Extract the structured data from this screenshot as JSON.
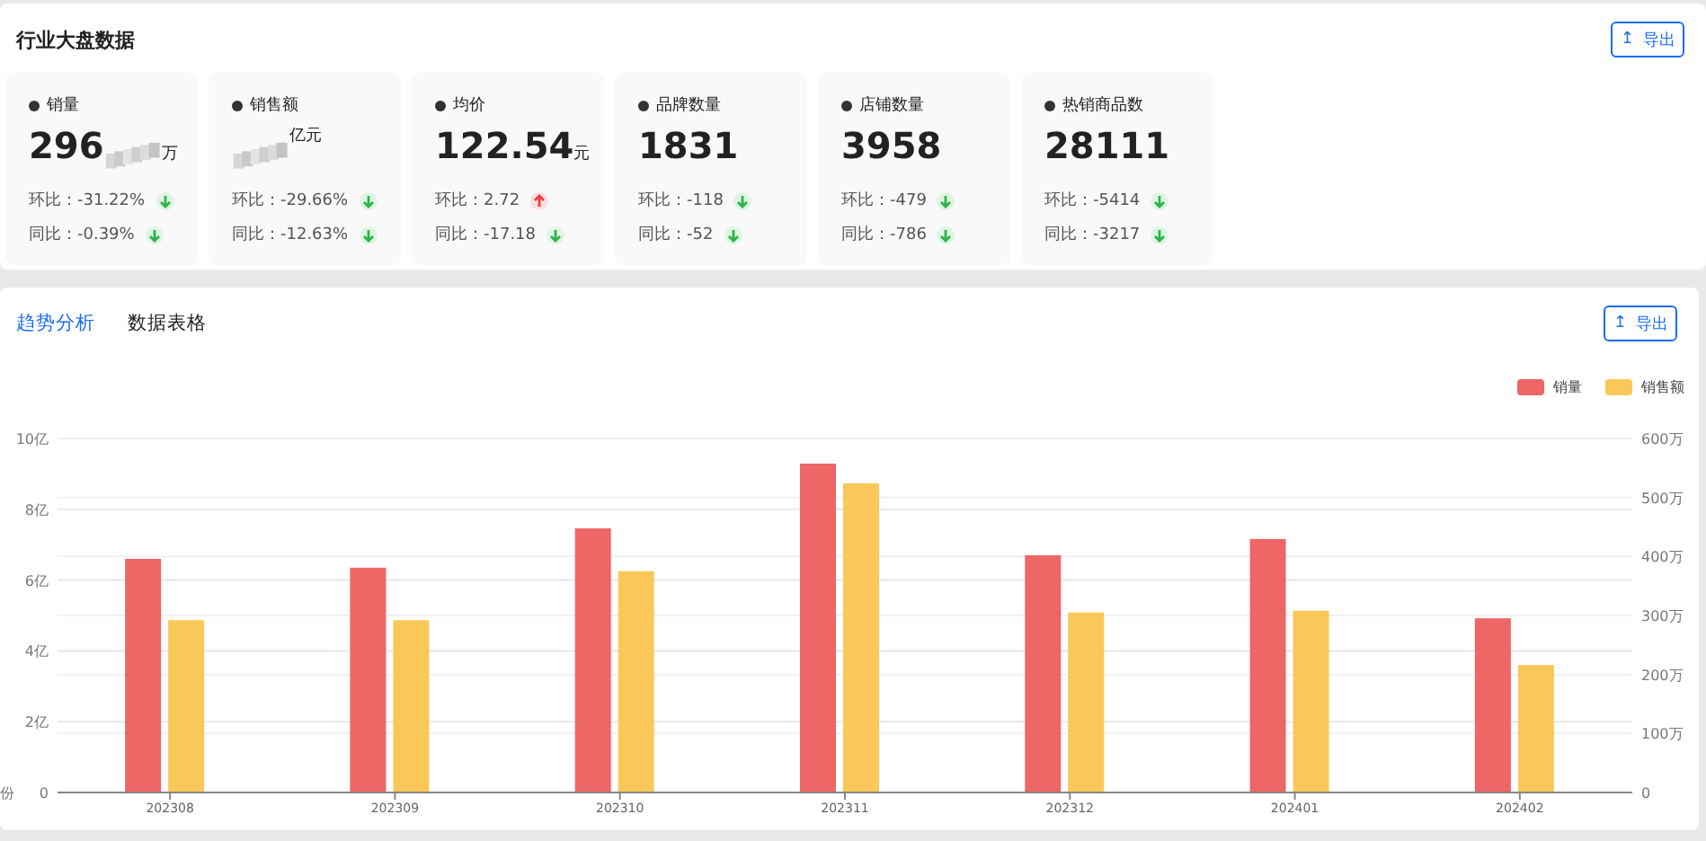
{
  "overview": {
    "title": "行业大盘数据",
    "export_button": {
      "icon": "↥",
      "label": "导出"
    },
    "cards": [
      {
        "label": "销量",
        "value": "296",
        "unit": "万",
        "redacted": true,
        "changes": [
          {
            "label": "环比：",
            "value": "-31.22%",
            "rising": false
          },
          {
            "label": "同比：",
            "value": "-0.39%",
            "rising": false
          }
        ]
      },
      {
        "label": "销售额",
        "unit": "亿元",
        "redacted": true,
        "changes": [
          {
            "label": "环比：",
            "value": "-29.66%",
            "rising": false
          },
          {
            "label": "同比：",
            "value": "-12.63%",
            "rising": false
          }
        ]
      },
      {
        "label": "均价",
        "value": "122.54",
        "unit": "元",
        "redacted": false,
        "changes": [
          {
            "label": "环比：",
            "value": "2.72",
            "rising": true
          },
          {
            "label": "同比：",
            "value": "-17.18",
            "rising": false
          }
        ]
      },
      {
        "label": "品牌数量",
        "value": "1831",
        "redacted": false,
        "changes": [
          {
            "label": "环比：",
            "value": "-118",
            "rising": false
          },
          {
            "label": "同比：",
            "value": "-52",
            "rising": false
          }
        ]
      },
      {
        "label": "店铺数量",
        "value": "3958",
        "redacted": false,
        "changes": [
          {
            "label": "环比：",
            "value": "-479",
            "rising": false
          },
          {
            "label": "同比：",
            "value": "-786",
            "rising": false
          }
        ]
      },
      {
        "label": "热销商品数",
        "value": "28111",
        "redacted": false,
        "changes": [
          {
            "label": "环比：",
            "value": "-5414",
            "rising": false
          },
          {
            "label": "同比：",
            "value": "-3217",
            "rising": false
          }
        ]
      }
    ]
  },
  "trend": {
    "tabs": [
      {
        "label": "趋势分析",
        "selected": true
      },
      {
        "label": "数据表格",
        "selected": false
      }
    ],
    "export_button": {
      "icon": "↥",
      "label": "导出"
    },
    "chart_data": {
      "type": "bar",
      "grid": true,
      "xlabel": "份",
      "categories": [
        "202308",
        "202309",
        "202310",
        "202311",
        "202312",
        "202401",
        "202402"
      ],
      "series": [
        {
          "name": "销量",
          "color": "#ee6666",
          "values": [
            6.6,
            6.35,
            7.46,
            9.29,
            6.7,
            7.16,
            4.92
          ]
        },
        {
          "name": "销售额",
          "color": "#fac858",
          "axis": "y2",
          "values": [
            292,
            292,
            375,
            524,
            305,
            308,
            216
          ]
        }
      ],
      "ylim": [
        0,
        10
      ],
      "yticks": [
        {
          "value": 0,
          "label": "0"
        },
        {
          "value": 2,
          "label": "2亿"
        },
        {
          "value": 4,
          "label": "4亿"
        },
        {
          "value": 6,
          "label": "6亿"
        },
        {
          "value": 8,
          "label": "8亿"
        },
        {
          "value": 10,
          "label": "10亿"
        }
      ],
      "y2lim": [
        0,
        600
      ],
      "y2ticks": [
        {
          "value": 0,
          "label": "0"
        },
        {
          "value": 100,
          "label": "100万"
        },
        {
          "value": 200,
          "label": "200万"
        },
        {
          "value": 300,
          "label": "300万"
        },
        {
          "value": 400,
          "label": "400万"
        },
        {
          "value": 500,
          "label": "500万"
        },
        {
          "value": 600,
          "label": "600万"
        }
      ]
    }
  }
}
